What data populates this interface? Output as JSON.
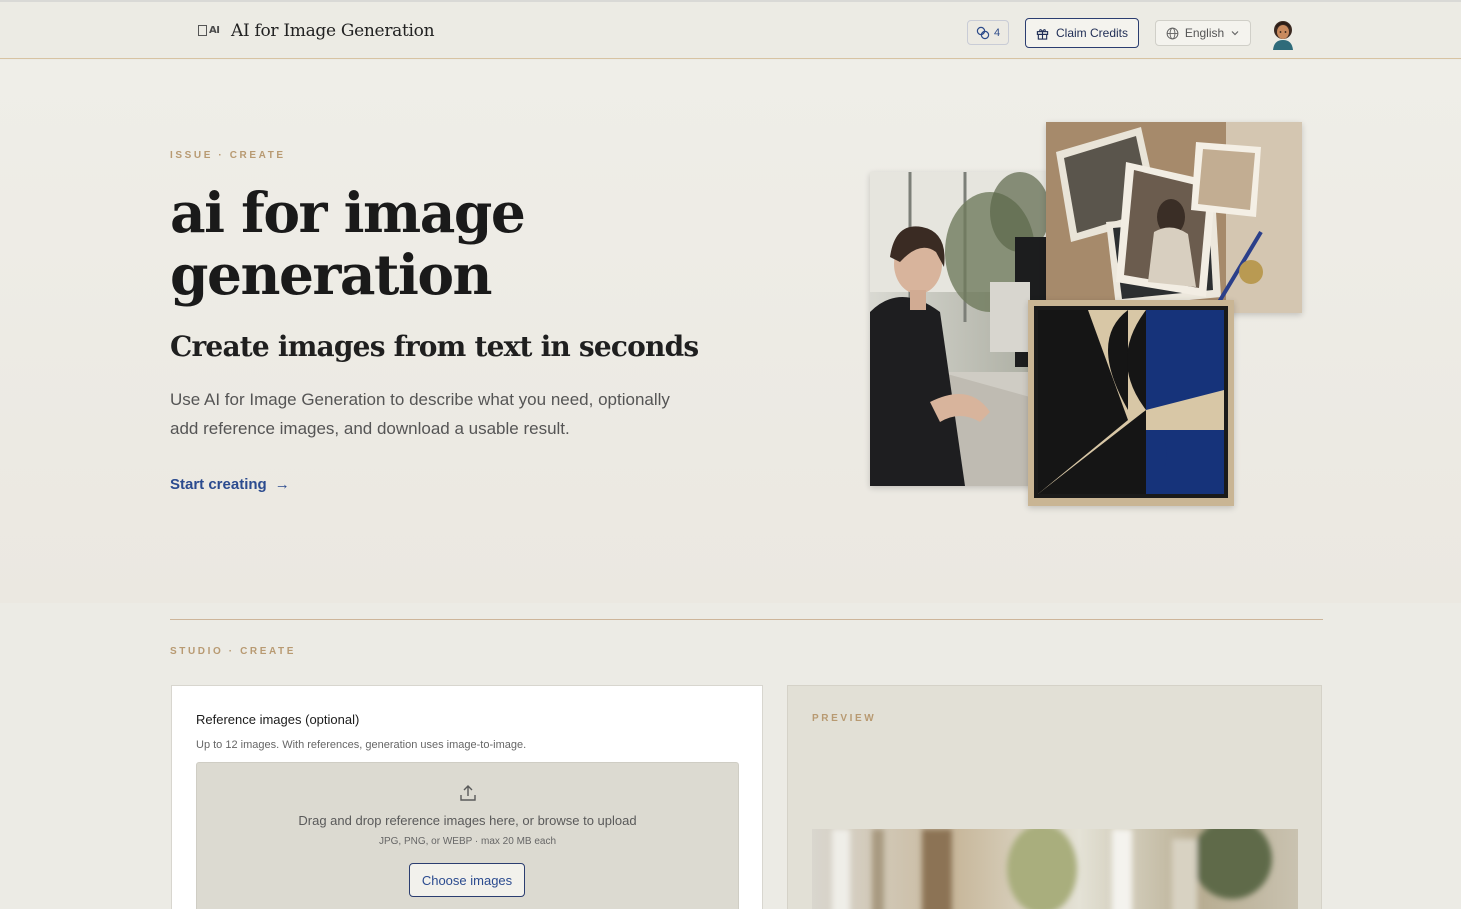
{
  "header": {
    "brand_mark": "AI",
    "brand": "AI for Image Generation",
    "credits_count": "4",
    "claim_label": "Claim Credits",
    "language": "English"
  },
  "hero": {
    "eyebrow": "ISSUE · CREATE",
    "title": "ai for image generation",
    "subtitle": "Create images from text in seconds",
    "description": "Use AI for Image Generation to describe what you need, optionally add reference images, and download a usable result.",
    "cta": "Start creating",
    "cta_arrow": "→"
  },
  "studio": {
    "eyebrow": "STUDIO · CREATE",
    "reference": {
      "title": "Reference images (optional)",
      "hint": "Up to 12 images. With references, generation uses image-to-image.",
      "drop_text": "Drag and drop reference images here, or browse to upload",
      "formats": "JPG, PNG, or WEBP · max 20 MB each",
      "button": "Choose images"
    },
    "preview": {
      "label": "PREVIEW"
    }
  }
}
